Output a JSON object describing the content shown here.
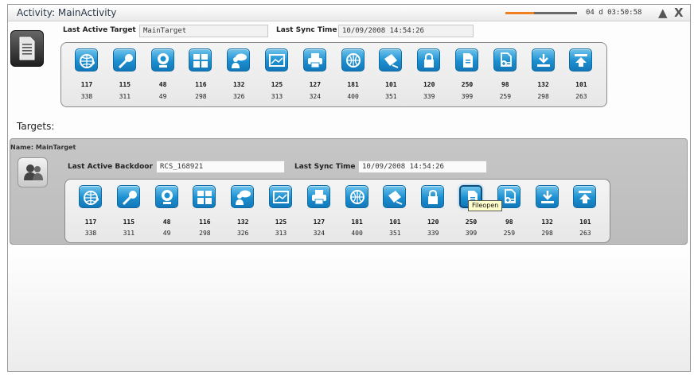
{
  "window": {
    "title": "Activity: MainActivity",
    "timer": "04 d 03:50:58",
    "progress_percent": 40,
    "progress_color": "#f08020",
    "buttons": [
      {
        "name": "triangle-up-icon",
        "glyph": "▲"
      },
      {
        "name": "close-icon",
        "glyph": "X"
      }
    ]
  },
  "activity": {
    "last_active_target_label": "Last Active Target",
    "last_active_target_value": "MainTarget",
    "last_sync_label": "Last Sync Time",
    "last_sync_value": "10/09/2008 14:54:26",
    "icon": "document-icon"
  },
  "targets_heading": "Targets:",
  "target": {
    "name_label": "Name: MainTarget",
    "last_active_backdoor_label": "Last Active Backdoor",
    "last_active_backdoor_value": "RCS_168921",
    "last_sync_label": "Last Sync Time",
    "last_sync_value": "10/09/2008 14:54:26",
    "icon": "user-group-icon",
    "tooltip": "Fileopen",
    "selected_index": 10
  },
  "modules": [
    {
      "icon": "globe-pencil-icon",
      "count_a": "117",
      "count_b": "338"
    },
    {
      "icon": "microphone-icon",
      "count_a": "115",
      "count_b": "311"
    },
    {
      "icon": "webcam-icon",
      "count_a": "48",
      "count_b": "49"
    },
    {
      "icon": "window-panels-icon",
      "count_a": "116",
      "count_b": "298"
    },
    {
      "icon": "chat-user-icon",
      "count_a": "132",
      "count_b": "326"
    },
    {
      "icon": "screenshot-icon",
      "count_a": "125",
      "count_b": "313"
    },
    {
      "icon": "printer-icon",
      "count_a": "127",
      "count_b": "324"
    },
    {
      "icon": "globe-icon",
      "count_a": "181",
      "count_b": "400"
    },
    {
      "icon": "keyboard-hand-icon",
      "count_a": "101",
      "count_b": "351"
    },
    {
      "icon": "lock-icon",
      "count_a": "120",
      "count_b": "339"
    },
    {
      "icon": "file-open-icon",
      "count_a": "250",
      "count_b": "399"
    },
    {
      "icon": "file-add-icon",
      "count_a": "98",
      "count_b": "259"
    },
    {
      "icon": "download-icon",
      "count_a": "132",
      "count_b": "298"
    },
    {
      "icon": "upload-icon",
      "count_a": "101",
      "count_b": "263"
    }
  ]
}
